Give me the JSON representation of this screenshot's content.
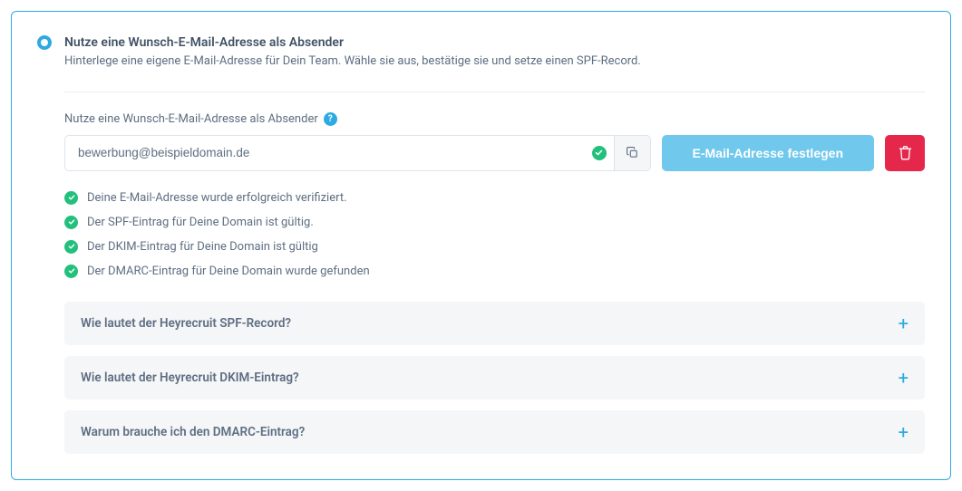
{
  "header": {
    "title": "Nutze eine Wunsch-E-Mail-Adresse als Absender",
    "subtitle": "Hinterlege eine eigene E-Mail-Adresse für Dein Team. Wähle sie aus, bestätige sie und setze einen SPF-Record."
  },
  "field": {
    "label": "Nutze eine Wunsch-E-Mail-Adresse als Absender",
    "help": "?",
    "value": "bewerbung@beispieldomain.de",
    "set_button": "E-Mail-Adresse festlegen"
  },
  "status": [
    {
      "text": "Deine E-Mail-Adresse wurde erfolgreich verifiziert."
    },
    {
      "text": "Der SPF-Eintrag für Deine Domain ist gültig."
    },
    {
      "text": "Der DKIM-Eintrag für Deine Domain ist gültig"
    },
    {
      "text": "Der DMARC-Eintrag für Deine Domain wurde gefunden"
    }
  ],
  "accordion": [
    {
      "title": "Wie lautet der Heyrecruit SPF-Record?"
    },
    {
      "title": "Wie lautet der Heyrecruit DKIM-Eintrag?"
    },
    {
      "title": "Warum brauche ich den DMARC-Eintrag?"
    }
  ]
}
